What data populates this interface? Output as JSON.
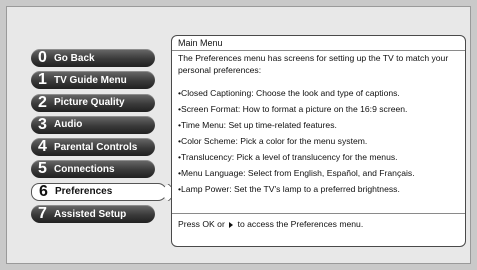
{
  "menu": {
    "items": [
      {
        "num": "0",
        "label": "Go Back"
      },
      {
        "num": "1",
        "label": "TV Guide Menu"
      },
      {
        "num": "2",
        "label": "Picture Quality"
      },
      {
        "num": "3",
        "label": "Audio"
      },
      {
        "num": "4",
        "label": "Parental Controls"
      },
      {
        "num": "5",
        "label": "Connections"
      },
      {
        "num": "6",
        "label": "Preferences"
      },
      {
        "num": "7",
        "label": "Assisted Setup"
      }
    ],
    "selected_index": 6
  },
  "panel": {
    "title": "Main Menu",
    "intro": "The Preferences menu has screens for setting up the TV to match your personal preferences:",
    "bullets": [
      "•Closed Captioning: Choose the look and type of captions.",
      "•Screen Format: How to format a picture on the 16:9 screen.",
      "•Time Menu: Set up time-related features.",
      "•Color Scheme: Pick a color for the menu system.",
      "•Translucency: Pick a level of translucency for the menus.",
      "•Menu Language: Select from English, Español, and Français.",
      "•Lamp Power: Set the TV's lamp to a preferred brightness."
    ],
    "footer_before": "Press OK or",
    "footer_after": "to access the Preferences menu."
  }
}
